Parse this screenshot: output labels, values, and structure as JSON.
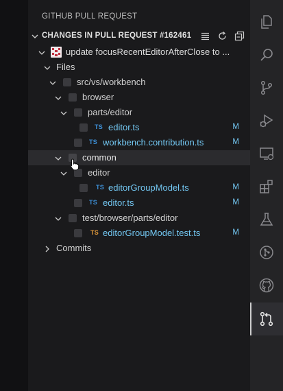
{
  "panel": {
    "title": "GITHUB PULL REQUEST",
    "section_label": "CHANGES IN PULL REQUEST #162461"
  },
  "tree": {
    "pr_title": "update focusRecentEditorAfterClose to ...",
    "files_label": "Files",
    "dir_src": "src/vs/workbench",
    "dir_browser": "browser",
    "dir_parts_editor": "parts/editor",
    "file_editor_ts_1": "editor.ts",
    "file_workbench_contribution": "workbench.contribution.ts",
    "dir_common": "common",
    "dir_editor": "editor",
    "file_editor_group_model": "editorGroupModel.ts",
    "file_editor_ts_2": "editor.ts",
    "dir_test": "test/browser/parts/editor",
    "file_editor_group_model_test": "editorGroupModel.test.ts",
    "commits_label": "Commits",
    "ts_tag": "TS",
    "modified_badge": "M"
  },
  "colors": {
    "ts_blue": "#3d8fd6",
    "ts_orange": "#e39a3b",
    "file_text": "#73c7f2",
    "activity_bg": "#242426",
    "panel_bg": "#1a1a1c"
  },
  "activity_bar": {
    "icons": [
      "explorer-icon",
      "search-icon",
      "source-control-icon",
      "run-debug-icon",
      "remote-explorer-icon",
      "extensions-icon",
      "testing-icon",
      "git-graph-icon",
      "github-icon",
      "pull-request-icon"
    ],
    "active": "pull-request-icon"
  }
}
